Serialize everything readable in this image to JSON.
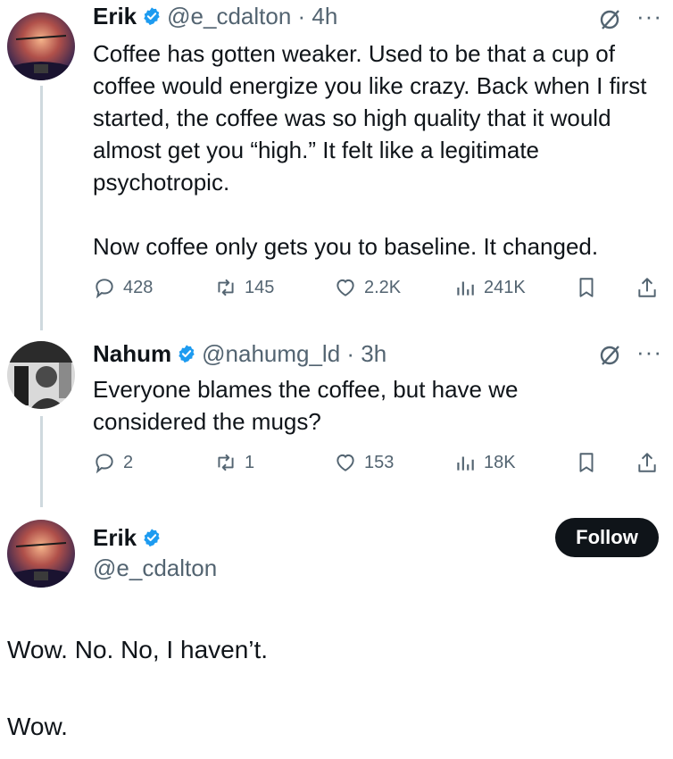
{
  "tweets": [
    {
      "name": "Erik",
      "handle_time": "@e_cdalton · 4h",
      "paragraphs": [
        "Coffee has gotten weaker. Used to be that a cup of coffee would energize you like crazy. Back when I first started, the coffee was so high quality that it would almost get you “high.” It felt like a legitimate psychotropic.",
        "Now coffee only gets you to baseline. It changed."
      ],
      "replies": "428",
      "reposts": "145",
      "likes": "2.2K",
      "views": "241K"
    },
    {
      "name": "Nahum",
      "handle_time": "@nahumg_ld · 3h",
      "paragraphs": [
        "Everyone blames the coffee, but have we considered the mugs?"
      ],
      "replies": "2",
      "reposts": "1",
      "likes": "153",
      "views": "18K"
    }
  ],
  "main_tweet": {
    "name": "Erik",
    "handle": "@e_cdalton",
    "follow_label": "Follow",
    "line1": "Wow. No. No, I haven’t.",
    "line2": "Wow."
  },
  "colors": {
    "verified": "#1d9bf0",
    "muted": "#536471",
    "follow_bg": "#0f1419"
  },
  "icons": [
    "verified-badge-icon",
    "grok-icon",
    "more-icon",
    "reply-icon",
    "repost-icon",
    "like-icon",
    "views-icon",
    "bookmark-icon",
    "share-icon"
  ]
}
